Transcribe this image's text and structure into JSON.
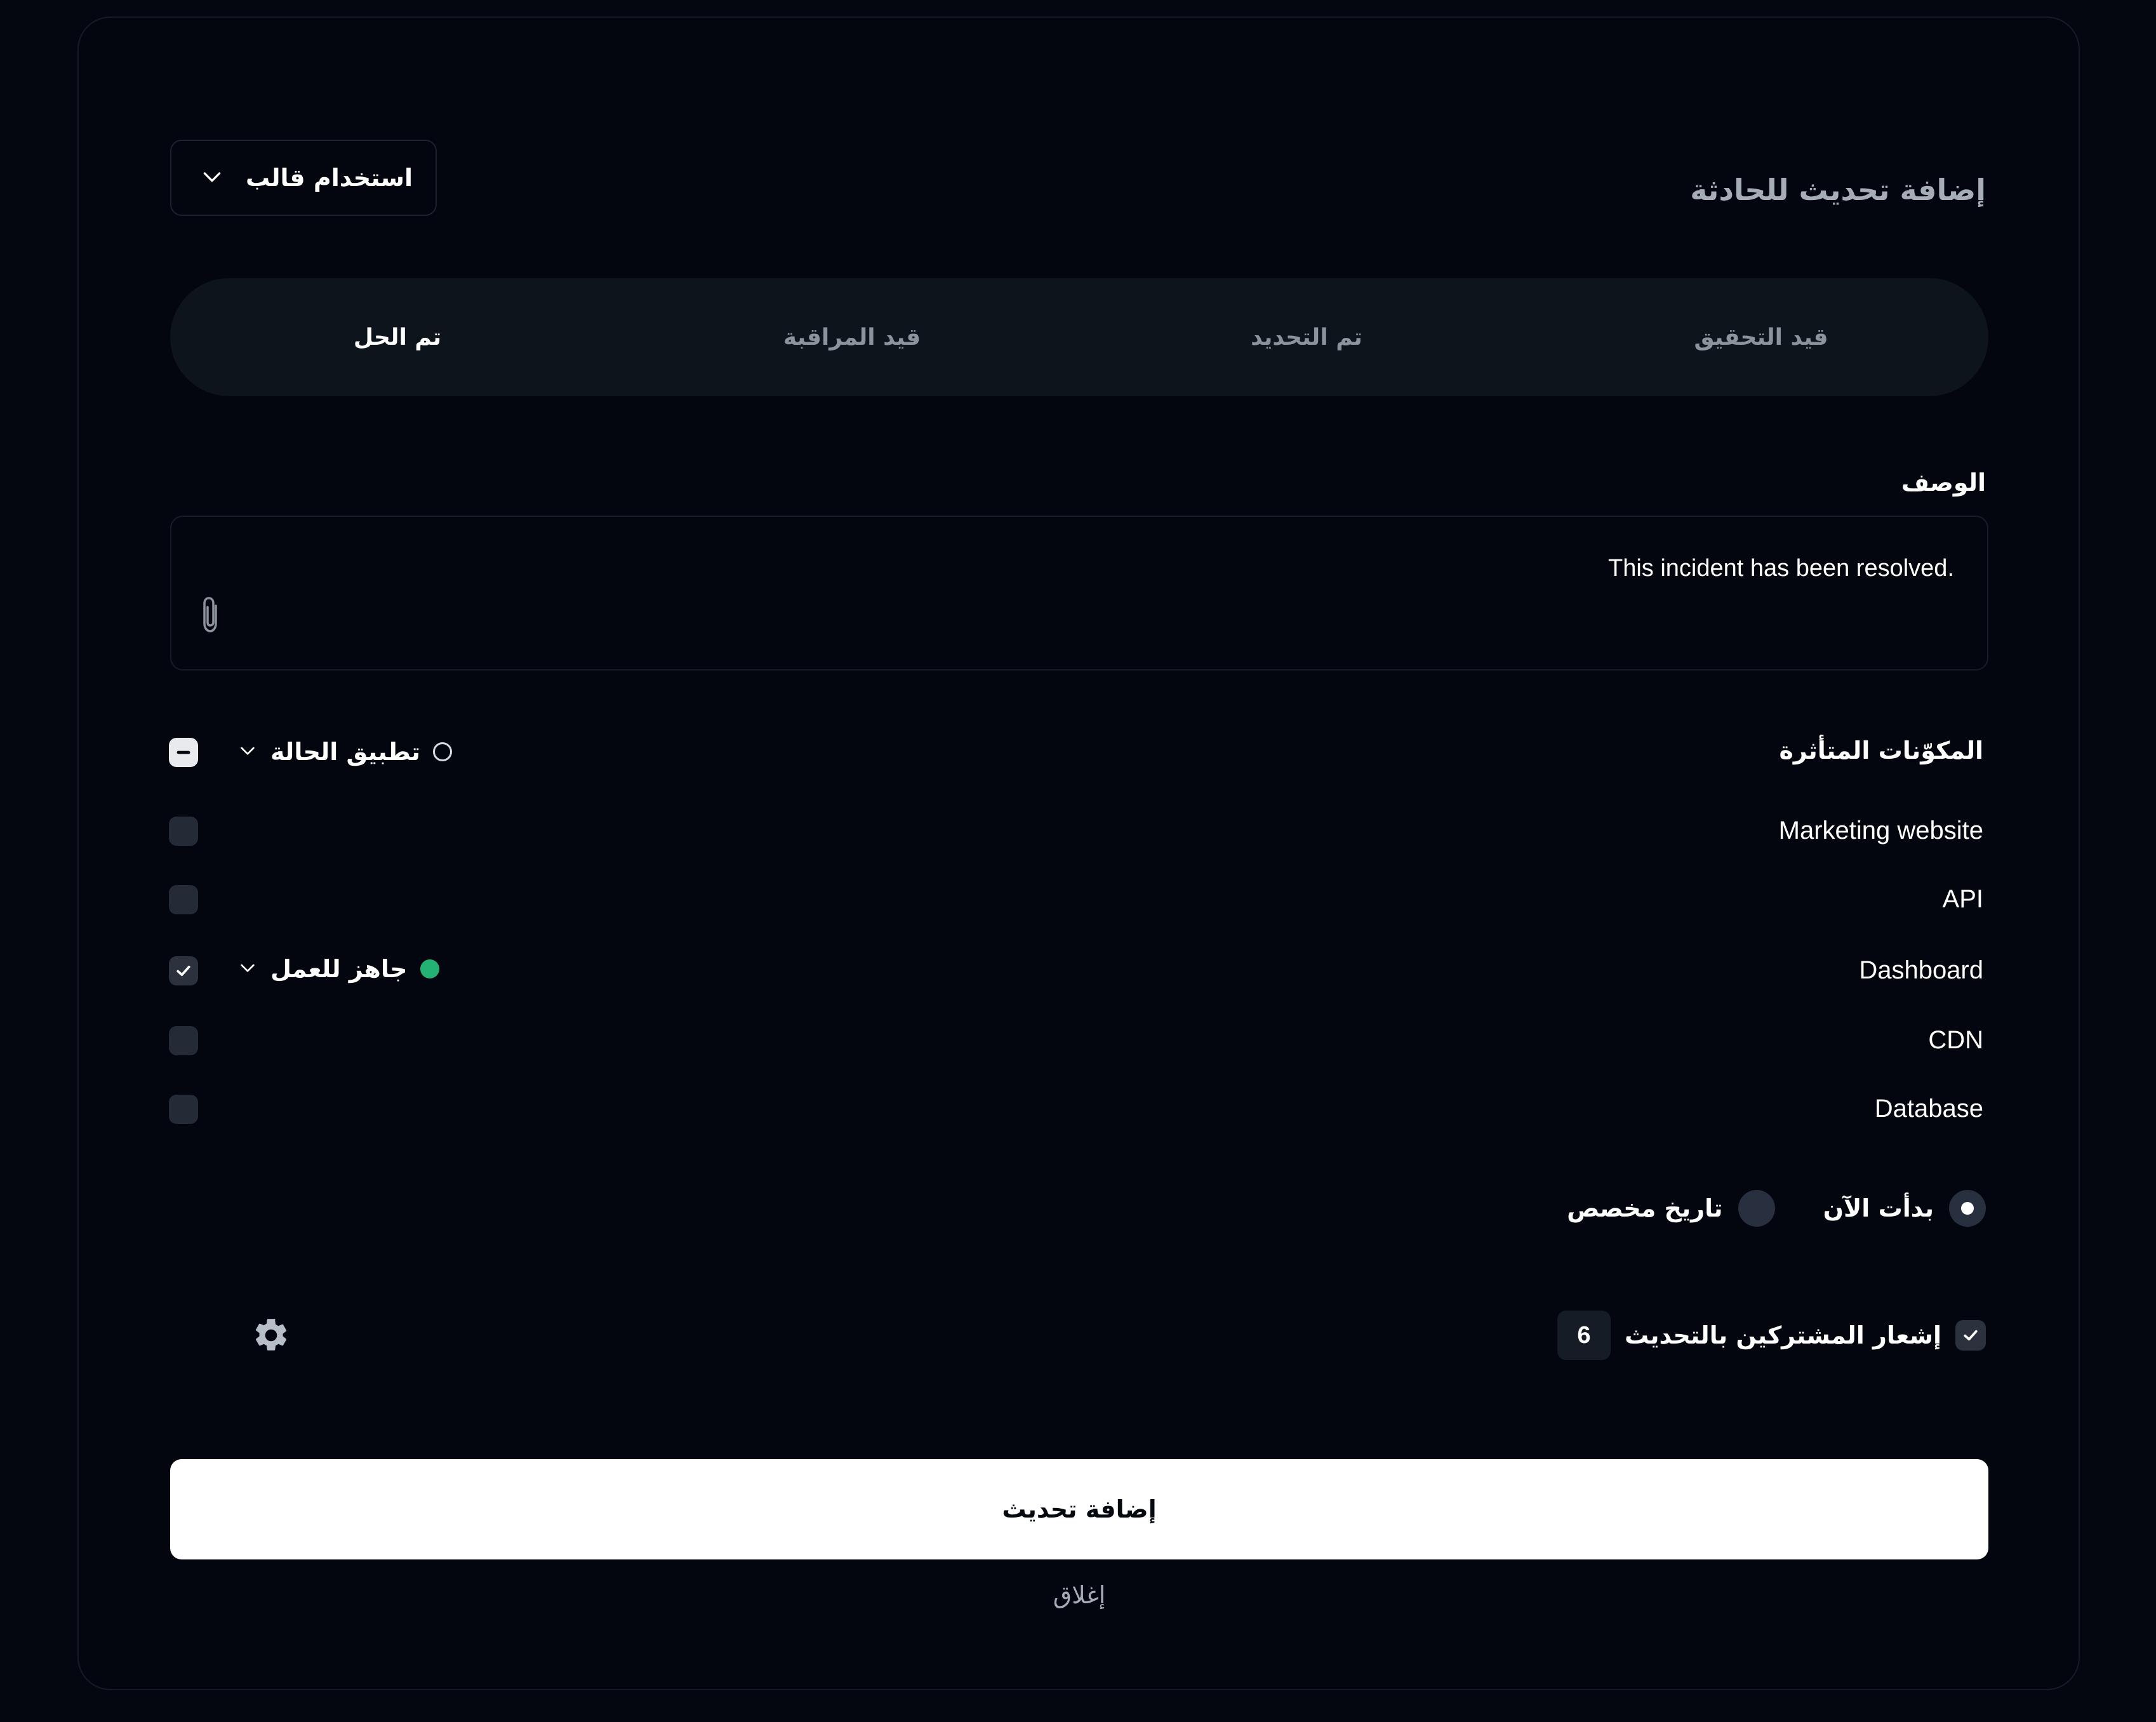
{
  "dialog": {
    "title": "إضافة تحديث للحادثة",
    "template_label": "استخدام قالب"
  },
  "tabs": [
    {
      "label": "قيد التحقيق",
      "active": false
    },
    {
      "label": "تم التحديد",
      "active": false
    },
    {
      "label": "قيد المراقبة",
      "active": false
    },
    {
      "label": "تم الحل",
      "active": true
    }
  ],
  "description": {
    "label": "الوصف",
    "value": ".This incident has been resolved"
  },
  "components": {
    "heading": "المكوّنات المتأثرة",
    "bulk_status_label": "تطبيق الحالة",
    "items": [
      {
        "name": "Marketing website",
        "checked": false
      },
      {
        "name": "API",
        "checked": false
      },
      {
        "name": "Dashboard",
        "checked": true,
        "status": "جاهز للعمل"
      },
      {
        "name": "CDN",
        "checked": false
      },
      {
        "name": "Database",
        "checked": false
      }
    ]
  },
  "start_time": {
    "now_label": "بدأت الآن",
    "custom_label": "تاريخ مخصص",
    "selected": "now"
  },
  "notify": {
    "label": "إشعار المشتركين بالتحديث",
    "count": "6",
    "checked": true
  },
  "actions": {
    "submit_label": "إضافة تحديث",
    "close_label": "إغلاق"
  },
  "colors": {
    "background": "#04070f",
    "status_green": "#23b274",
    "primary_button": "#ffffff"
  }
}
